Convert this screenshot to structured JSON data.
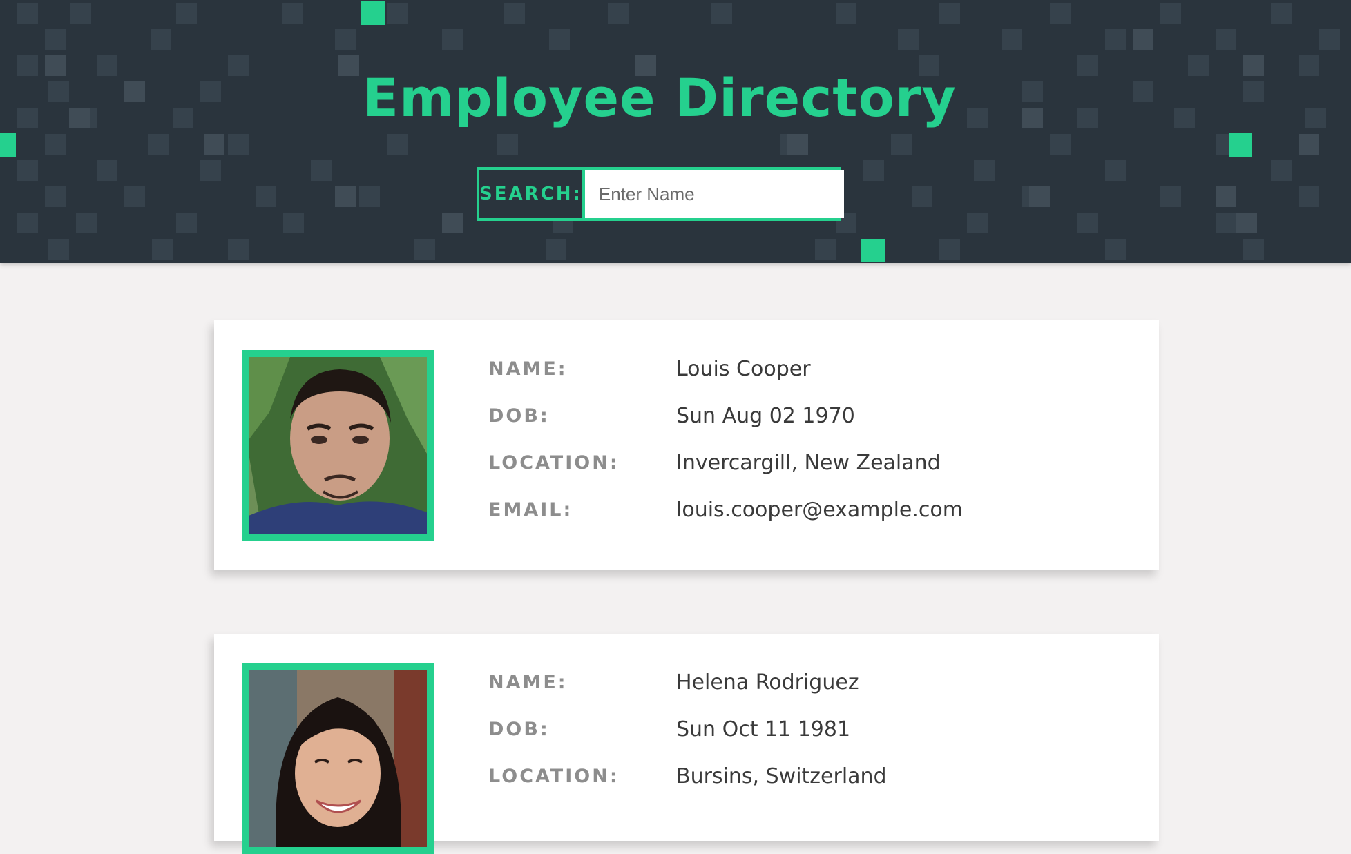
{
  "header": {
    "title": "Employee Directory",
    "search_label": "SEARCH:",
    "search_placeholder": "Enter Name",
    "search_value": ""
  },
  "employees": [
    {
      "name_label": "NAME:",
      "name": "Louis Cooper",
      "dob_label": "DOB:",
      "dob": "Sun Aug 02 1970",
      "location_label": "LOCATION:",
      "location": "Invercargill, New Zealand",
      "email_label": "EMAIL:",
      "email": "louis.cooper@example.com"
    },
    {
      "name_label": "NAME:",
      "name": "Helena Rodriguez",
      "dob_label": "DOB:",
      "dob": "Sun Oct 11 1981",
      "location_label": "LOCATION:",
      "location": "Bursins, Switzerland"
    }
  ],
  "colors": {
    "accent": "#25d08e",
    "header_bg": "#2a343d",
    "page_bg": "#f3f1f1",
    "label": "#8d8d8d",
    "value": "#3a3a3a"
  }
}
